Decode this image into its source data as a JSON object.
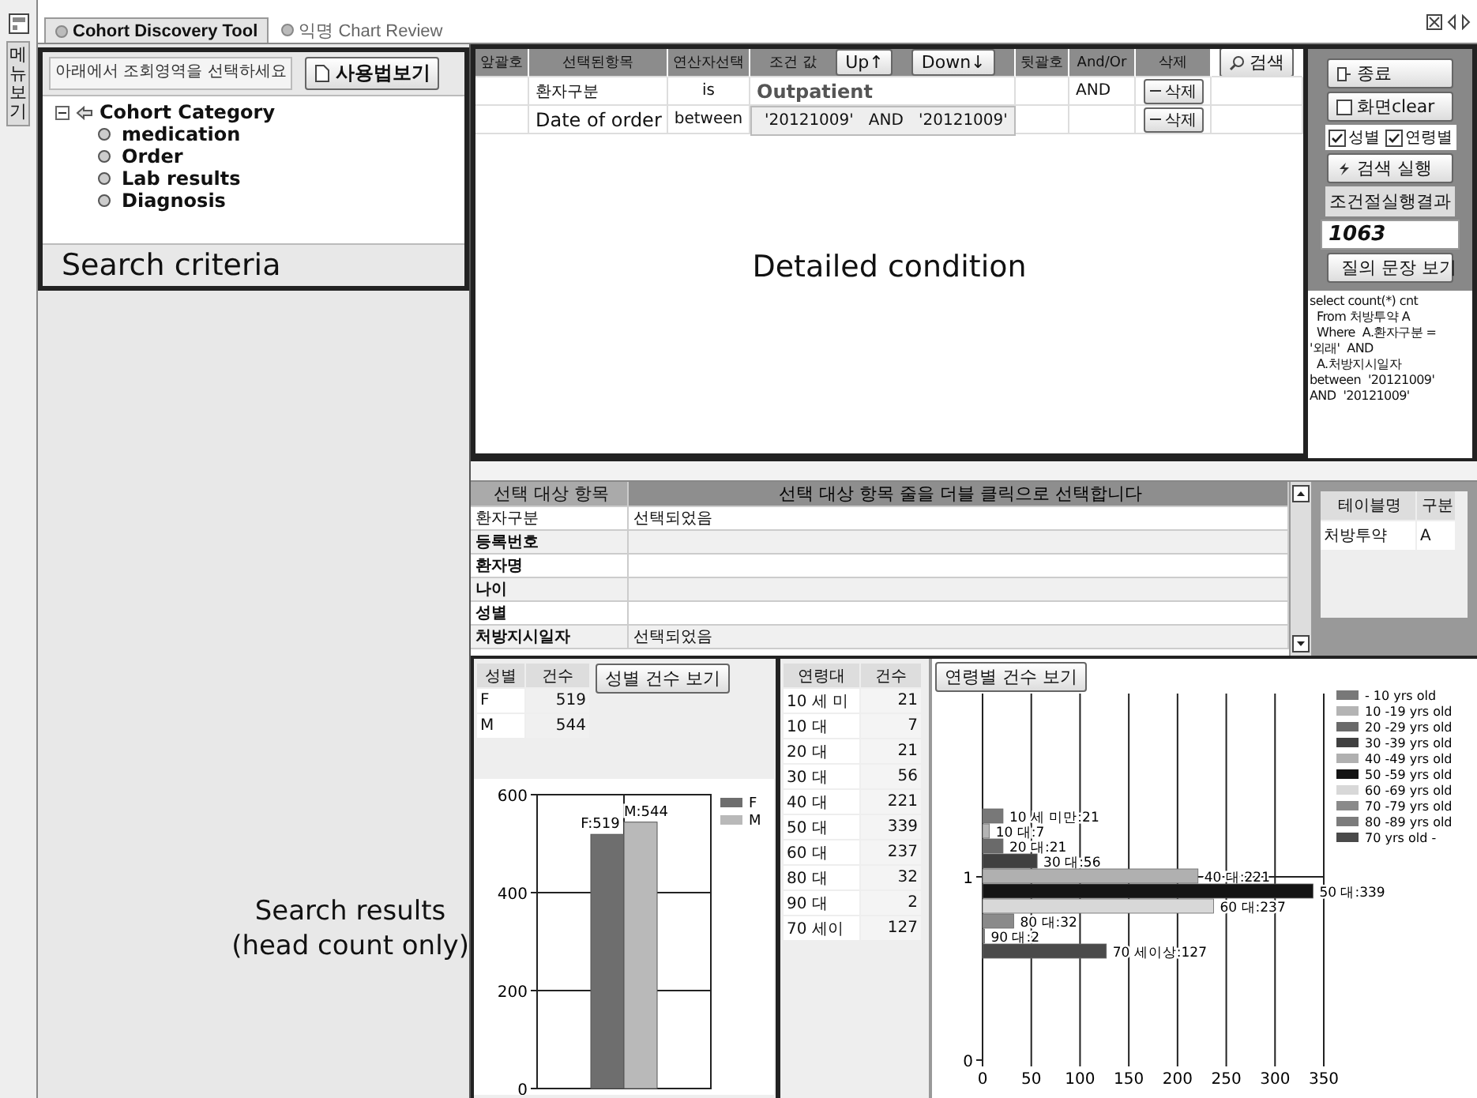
{
  "sidebar": {
    "label": "메뉴보기"
  },
  "tabs": [
    {
      "label": "Cohort Discovery Tool",
      "selected": true
    },
    {
      "label": "익명 Chart Review",
      "selected": false
    }
  ],
  "search_criteria": {
    "hint": "아래에서 조회영역을 선택하세요",
    "help_button": "사용법보기",
    "tree": [
      {
        "label": "Cohort Category",
        "expanded": true,
        "children": [
          {
            "label": "medication"
          },
          {
            "label": "Order"
          },
          {
            "label": "Lab results"
          },
          {
            "label": "Diagnosis"
          }
        ]
      }
    ],
    "caption": "Search criteria"
  },
  "condition": {
    "columns": [
      "앞괄호",
      "선택된항목",
      "연산자선택",
      "조건 값",
      "뒷괄호",
      "And/Or",
      "삭제"
    ],
    "up_button": "Up↑",
    "down_button": "Down↓",
    "search_button": "검색",
    "rows": [
      {
        "item": "환자구분",
        "operator": "is",
        "value": "Outpatient",
        "and_or": "AND",
        "delete": "삭제"
      },
      {
        "item": "Date of order",
        "operator": "between",
        "value": "'20121009'   AND   '20121009'",
        "delete": "삭제"
      }
    ],
    "caption": "Detailed condition"
  },
  "actions": {
    "exit": "종료",
    "clear": "화면clear",
    "checks": [
      {
        "label": "성별",
        "checked": true
      },
      {
        "label": "연령별",
        "checked": true
      }
    ],
    "run": "검색 실행",
    "result_label": "조건절실행결과",
    "result": "1063",
    "query_button": "질의 문장 보기",
    "query": [
      "select count(*) cnt",
      "  From 처방투약 A",
      "  Where  A.환자구분 =",
      "'외래'  AND",
      "  A.처방지시일자",
      "between  '20121009'",
      "AND  '20121009'"
    ]
  },
  "item_list": {
    "columns": [
      "선택 대상 항목",
      "선택 대상 항목 줄을 더블 클릭으로 선택합니다"
    ],
    "rows": [
      {
        "name": "환자구분",
        "status": "선택되었음"
      },
      {
        "name": "등록번호"
      },
      {
        "name": "환자명"
      },
      {
        "name": "나이"
      },
      {
        "name": "성별"
      },
      {
        "name": "처방지시일자",
        "status": "선택되었음"
      }
    ]
  },
  "table_list": {
    "columns": [
      "테이블명",
      "구분"
    ],
    "rows": [
      {
        "table": "처방투약",
        "alias": "A"
      }
    ]
  },
  "results": {
    "caption": [
      "Search results",
      "(head count only)"
    ],
    "sex": {
      "columns": [
        "성별",
        "건수"
      ],
      "rows": [
        {
          "label": "F",
          "count": "519"
        },
        {
          "label": "M",
          "count": "544"
        }
      ],
      "button": "성별 건수 보기",
      "chart_data": {
        "type": "bar",
        "series": [
          {
            "name": "F",
            "color": "#6e6e6e",
            "values": [
              519
            ]
          },
          {
            "name": "M",
            "color": "#b9b9b9",
            "values": [
              544
            ]
          }
        ],
        "value_labels": [
          "F:519",
          "M:544"
        ],
        "ylim": [
          0,
          600
        ],
        "yticks": [
          0,
          200,
          400,
          600
        ],
        "grid": true,
        "legend": true
      }
    },
    "age": {
      "columns": [
        "연령대",
        "건수"
      ],
      "rows": [
        {
          "label": "10 세 미",
          "count": "21"
        },
        {
          "label": "10 대",
          "count": "7"
        },
        {
          "label": "20 대",
          "count": "21"
        },
        {
          "label": "30 대",
          "count": "56"
        },
        {
          "label": "40 대",
          "count": "221"
        },
        {
          "label": "50 대",
          "count": "339"
        },
        {
          "label": "60 대",
          "count": "237"
        },
        {
          "label": "80 대",
          "count": "32"
        },
        {
          "label": "90 대",
          "count": "2"
        },
        {
          "label": "70 세이",
          "count": "127"
        }
      ],
      "button": "연령별 건수 보기",
      "chart_data": {
        "type": "bar",
        "orientation": "horizontal",
        "series": [
          {
            "name": "- 10 yrs old",
            "color": "#787878",
            "values": [
              21
            ]
          },
          {
            "name": "10 -19 yrs old",
            "color": "#b4b4b4",
            "values": [
              7
            ]
          },
          {
            "name": "20 -29 yrs old",
            "color": "#6a6a6a",
            "values": [
              21
            ]
          },
          {
            "name": "30 -39 yrs old",
            "color": "#404040",
            "values": [
              56
            ]
          },
          {
            "name": "40 -49 yrs old",
            "color": "#b0b0b0",
            "values": [
              221
            ]
          },
          {
            "name": "50 -59 yrs old",
            "color": "#141414",
            "values": [
              339
            ]
          },
          {
            "name": "60 -69 yrs old",
            "color": "#d8d8d8",
            "values": [
              237
            ]
          },
          {
            "name": "70 -79 yrs old",
            "color": "#8a8a8a",
            "values": [
              32
            ]
          },
          {
            "name": "80 -89 yrs old",
            "color": "#7c7c7c",
            "values": [
              2
            ]
          },
          {
            "name": "70 yrs old -",
            "color": "#4a4a4a",
            "values": [
              127
            ]
          }
        ],
        "value_labels": [
          "10 세 미만:21",
          "10 대:7",
          "20 대:21",
          "30 대:56",
          "40 대:221",
          "50 대:339",
          "60 대:237",
          "80 대:32",
          "90 대:2",
          "70 세이상:127"
        ],
        "xlim": [
          0,
          350
        ],
        "xticks": [
          0,
          50,
          100,
          150,
          200,
          250,
          300,
          350
        ],
        "grid": true,
        "legend": true
      },
      "y_axis_labels": [
        "1",
        "0"
      ]
    }
  }
}
